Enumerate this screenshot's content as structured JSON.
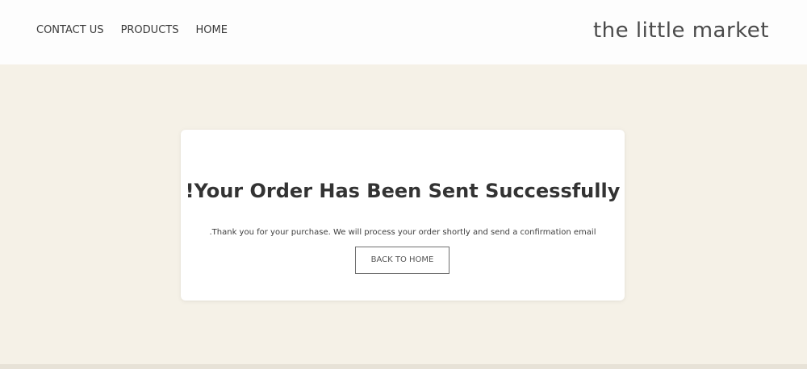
{
  "header": {
    "nav": [
      {
        "label": "CONTACT US"
      },
      {
        "label": "PRODUCTS"
      },
      {
        "label": "HOME"
      }
    ],
    "logo": "the little market"
  },
  "confirmation": {
    "title": "!Your Order Has Been Sent Successfully",
    "message": ".Thank you for your purchase. We will process your order shortly and send a confirmation email",
    "button_label": "BACK TO HOME"
  },
  "colors": {
    "page_background": "#f5f1e7",
    "header_background": "#fdfdfd",
    "card_background": "#ffffff",
    "text": "#333333"
  }
}
